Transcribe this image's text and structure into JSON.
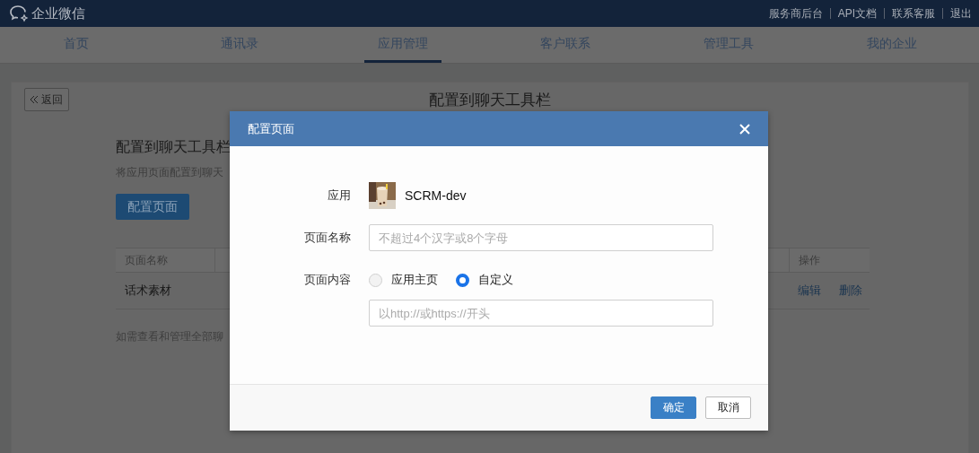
{
  "top_bar": {
    "logo_text": "企业微信",
    "links": [
      "服务商后台",
      "API文档",
      "联系客服",
      "退出"
    ]
  },
  "nav": {
    "tabs": [
      {
        "label": "首页",
        "selected": false
      },
      {
        "label": "通讯录",
        "selected": false
      },
      {
        "label": "应用管理",
        "selected": true
      },
      {
        "label": "客户联系",
        "selected": false
      },
      {
        "label": "管理工具",
        "selected": false
      },
      {
        "label": "我的企业",
        "selected": false
      }
    ]
  },
  "page": {
    "back_button": "返回",
    "title": "配置到聊天工具栏",
    "section_title": "配置到聊天工具栏",
    "description": "将应用页面配置到聊天",
    "primary_button": "配置页面",
    "table": {
      "columns": [
        "页面名称",
        "操作"
      ],
      "rows": [
        {
          "cells": [
            "话术素材"
          ],
          "actions": [
            "编辑",
            "删除"
          ]
        }
      ]
    },
    "note": "如需查看和管理全部聊"
  },
  "dialog": {
    "title": "配置页面",
    "app": {
      "label": "应用",
      "name": "SCRM-dev"
    },
    "page_name": {
      "label": "页面名称",
      "placeholder": "不超过4个汉字或8个字母"
    },
    "page_content": {
      "label": "页面内容",
      "options": [
        {
          "label": "应用主页",
          "selected": false
        },
        {
          "label": "自定义",
          "selected": true
        }
      ],
      "placeholder": "以http://或https://开头"
    },
    "buttons": [
      {
        "label": "确定",
        "kind": "primary"
      },
      {
        "label": "取消",
        "kind": "default"
      }
    ]
  }
}
